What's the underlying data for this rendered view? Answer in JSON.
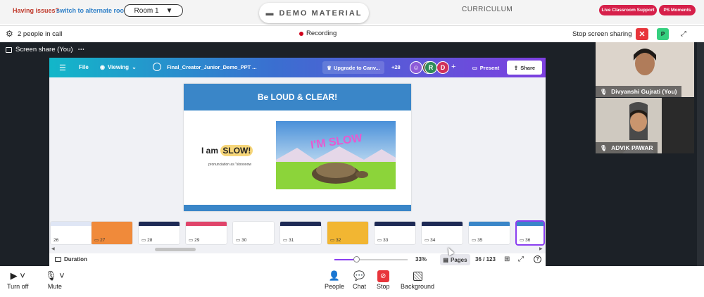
{
  "topbar": {
    "issues_text": "Having issues?",
    "alt_room_link": "switch to alternate room",
    "room_select": "Room 1",
    "demo_material": "DEMO MATERIAL",
    "curriculum": "CURRICULUM",
    "live_support": "Live Classroom Support",
    "ps_moments": "PS Moments"
  },
  "call": {
    "people_count": "2 people in call",
    "recording": "Recording",
    "stop_sharing": "Stop screen sharing",
    "self_initial": "P",
    "share_label": "Screen share (You)"
  },
  "canva": {
    "file": "File",
    "viewing": "Viewing",
    "doc_title": "Final_Creator_Junior_Demo_PPT ...",
    "upgrade": "Upgrade to Canv...",
    "collab_count": "+28",
    "avatar_r": "R",
    "avatar_d": "D",
    "present": "Present",
    "share": "Share",
    "slide": {
      "header": "Be LOUD & CLEAR!",
      "i_am": "I am",
      "slow": "SLOW!",
      "pronunciation": "pronunciation as \"slooooow",
      "image_caption": "I'M SLOW"
    },
    "thumbnails": [
      {
        "num": "26"
      },
      {
        "num": "27"
      },
      {
        "num": "28"
      },
      {
        "num": "29"
      },
      {
        "num": "30"
      },
      {
        "num": "31"
      },
      {
        "num": "32"
      },
      {
        "num": "33"
      },
      {
        "num": "34"
      },
      {
        "num": "35"
      },
      {
        "num": "36"
      }
    ],
    "duration": "Duration",
    "zoom": "33%",
    "zoom_fraction": 0.3,
    "pages": "Pages",
    "page_count": "36 / 123"
  },
  "participants": [
    {
      "name": "Divyanshi Gujrati (You)"
    },
    {
      "name": "ADVIK PAWAR"
    }
  ],
  "toolbar": {
    "turn_off": "Turn off",
    "mute": "Mute",
    "people": "People",
    "chat": "Chat",
    "stop": "Stop",
    "background": "Background"
  },
  "colors": {
    "brand_red": "#d6204a",
    "link_blue": "#2f80c8",
    "slide_blue": "#3a86c8",
    "canva_purple": "#7e3fe0",
    "recording_red": "#d0021b",
    "self_green": "#35d07f"
  }
}
